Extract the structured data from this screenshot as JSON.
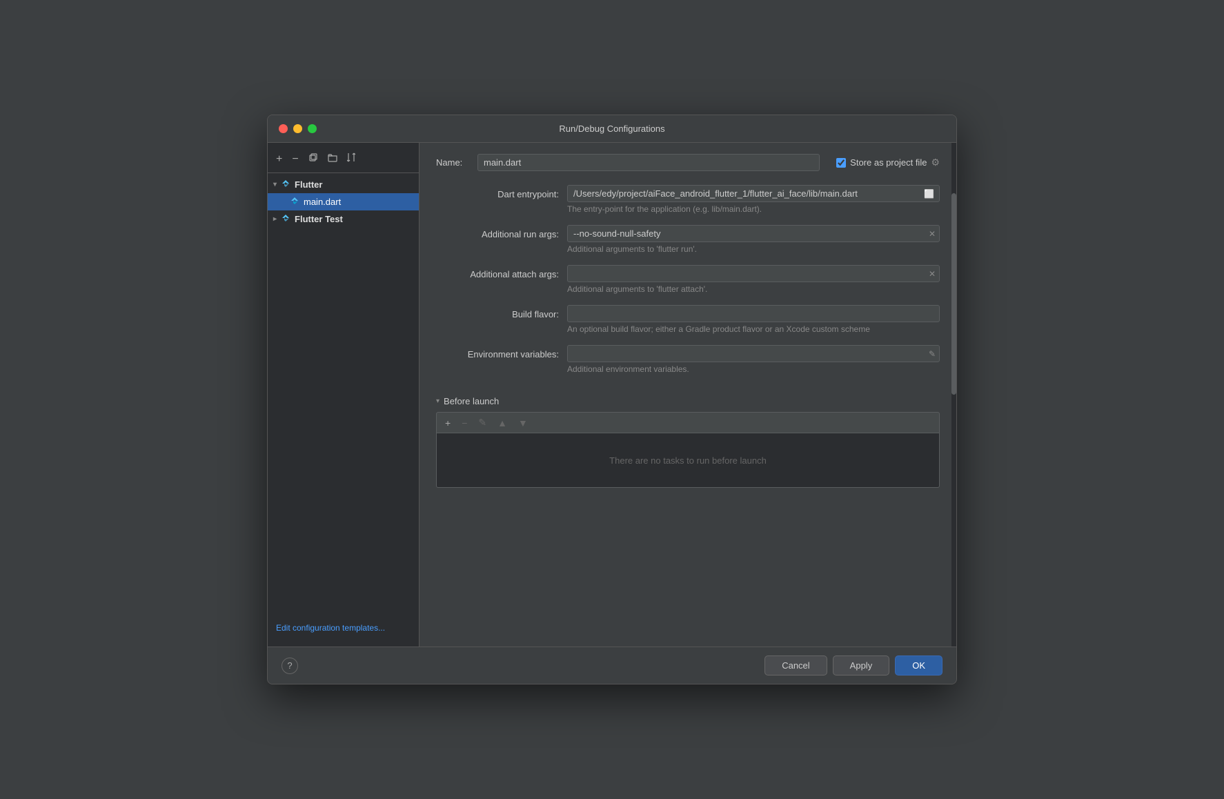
{
  "dialog": {
    "title": "Run/Debug Configurations"
  },
  "sidebar": {
    "add_label": "+",
    "remove_label": "−",
    "copy_label": "⊕",
    "folder_label": "📁",
    "sort_label": "↕",
    "groups": [
      {
        "label": "Flutter",
        "expanded": true,
        "items": [
          {
            "label": "main.dart",
            "selected": true
          }
        ]
      },
      {
        "label": "Flutter Test",
        "expanded": false,
        "items": []
      }
    ],
    "edit_templates_label": "Edit configuration templates..."
  },
  "config": {
    "name_label": "Name:",
    "name_value": "main.dart",
    "store_label": "Store as project file",
    "dart_entrypoint_label": "Dart entrypoint:",
    "dart_entrypoint_value": "/Users/edy/project/aiFace_android_flutter_1/flutter_ai_face/lib/main.dart",
    "dart_entrypoint_hint": "The entry-point for the application (e.g. lib/main.dart).",
    "additional_run_args_label": "Additional run args:",
    "additional_run_args_value": "--no-sound-null-safety",
    "additional_run_args_hint": "Additional arguments to 'flutter run'.",
    "additional_attach_args_label": "Additional attach args:",
    "additional_attach_args_value": "",
    "additional_attach_args_hint": "Additional arguments to 'flutter attach'.",
    "build_flavor_label": "Build flavor:",
    "build_flavor_value": "",
    "build_flavor_hint": "An optional build flavor; either a Gradle product flavor or an Xcode custom scheme",
    "env_vars_label": "Environment variables:",
    "env_vars_value": "",
    "env_vars_hint": "Additional environment variables.",
    "before_launch_label": "Before launch",
    "no_tasks_text": "There are no tasks to run before launch"
  },
  "footer": {
    "help_label": "?",
    "cancel_label": "Cancel",
    "apply_label": "Apply",
    "ok_label": "OK"
  },
  "icons": {
    "chevron_down": "▾",
    "chevron_right": "▸",
    "flutter_color": "#54C5F8",
    "add": "+",
    "remove": "−",
    "copy": "⊕",
    "folder": "📂",
    "sort": "⇅",
    "edit_pencil": "✎",
    "arrow_up": "▲",
    "arrow_down": "▼"
  }
}
